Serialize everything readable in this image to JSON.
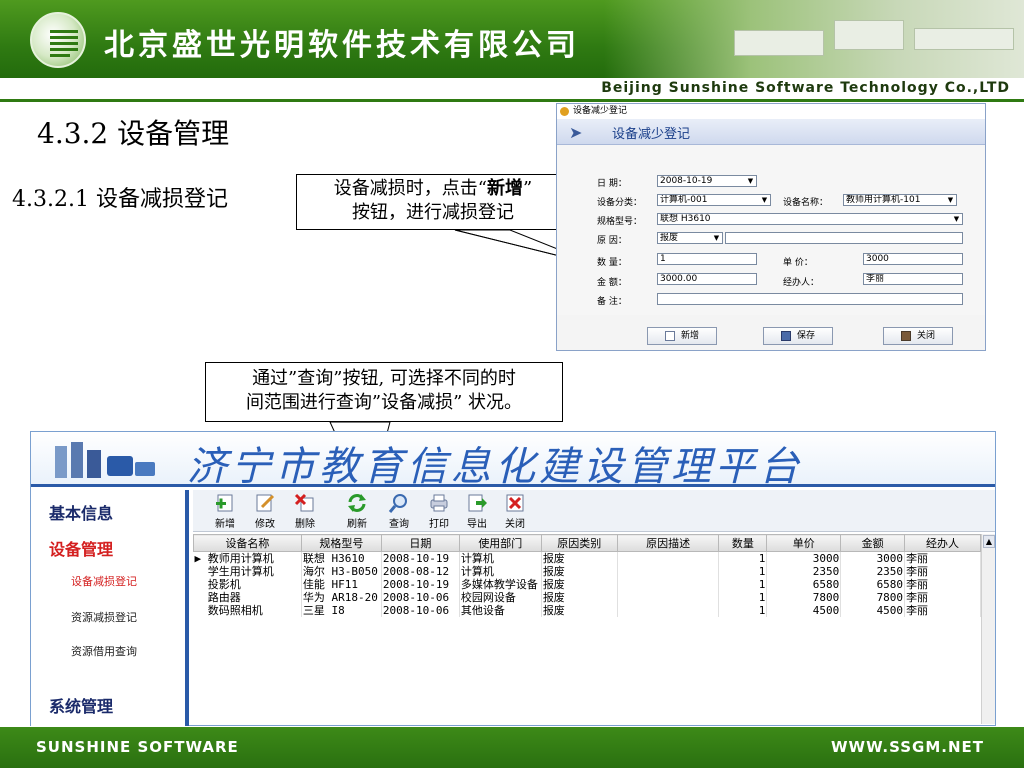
{
  "banner": {
    "company_cn": "北京盛世光明软件技术有限公司",
    "company_en": "Beijing Sunshine Software Technology Co.,LTD"
  },
  "headings": {
    "section": "4.3.2 设备管理",
    "subsection": "4.3.2.1 设备减损登记"
  },
  "callouts": {
    "add_hint_line1_pre": "设备减损时，点击“",
    "add_hint_bold": "新增",
    "add_hint_line1_post": "”",
    "add_hint_line2": "按钮，进行减损登记",
    "query_hint_line1": "通过”查询”按钮, 可选择不同的时",
    "query_hint_line2": "间范围进行查询”设备减损” 状况。"
  },
  "dialog": {
    "window_title": "设备减少登记",
    "header_title": "设备减少登记",
    "labels": {
      "date": "日  期：",
      "category": "设备分类：",
      "name": "设备名称：",
      "model": "规格型号：",
      "reason": "原  因：",
      "quantity": "数  量：",
      "unit_price": "单  价：",
      "amount": "金  额：",
      "handler": "经办人：",
      "note": "备  注："
    },
    "values": {
      "date": "2008-10-19",
      "category": "计算机-001",
      "name": "教师用计算机-101",
      "model": "联想 H3610",
      "reason": "报废",
      "reason_detail": "",
      "quantity": "1",
      "unit_price": "3000",
      "amount": "3000.00",
      "handler": "李丽",
      "note": ""
    },
    "buttons": {
      "add": "新增",
      "save": "保存",
      "close": "关闭"
    }
  },
  "app": {
    "title": "济宁市教育信息化建设管理平台",
    "sidebar": {
      "basic_info": "基本信息",
      "device_mgmt": "设备管理",
      "device_loss": "设备减损登记",
      "resource_loss": "资源减损登记",
      "resource_borrow": "资源借用查询",
      "system_mgmt": "系统管理"
    },
    "toolbar": {
      "add": "新增",
      "edit": "修改",
      "delete": "删除",
      "refresh": "刷新",
      "query": "查询",
      "print": "打印",
      "export": "导出",
      "close": "关闭"
    },
    "table": {
      "columns": [
        "设备名称",
        "规格型号",
        "日期",
        "使用部门",
        "原因类别",
        "原因描述",
        "数量",
        "单价",
        "金额",
        "经办人"
      ],
      "rows": [
        [
          "教师用计算机",
          "联想 H3610",
          "2008-10-19",
          "计算机",
          "报废",
          "",
          "1",
          "3000",
          "3000",
          "李丽"
        ],
        [
          "学生用计算机",
          "海尔 H3-B050",
          "2008-08-12",
          "计算机",
          "报废",
          "",
          "1",
          "2350",
          "2350",
          "李丽"
        ],
        [
          "投影机",
          "佳能 HF11",
          "2008-10-19",
          "多媒体教学设备",
          "报废",
          "",
          "1",
          "6580",
          "6580",
          "李丽"
        ],
        [
          "路由器",
          "华为 AR18-20",
          "2008-10-06",
          "校园网设备",
          "报废",
          "",
          "1",
          "7800",
          "7800",
          "李丽"
        ],
        [
          "数码照相机",
          "三星 I8",
          "2008-10-06",
          "其他设备",
          "报废",
          "",
          "1",
          "4500",
          "4500",
          "李丽"
        ]
      ]
    }
  },
  "footer": {
    "left": "SUNSHINE SOFTWARE",
    "right": "WWW.SSGM.NET"
  },
  "colors": {
    "brand_green": "#2f7a12",
    "app_blue": "#2a5aa8",
    "sidebar_red": "#d42020"
  }
}
